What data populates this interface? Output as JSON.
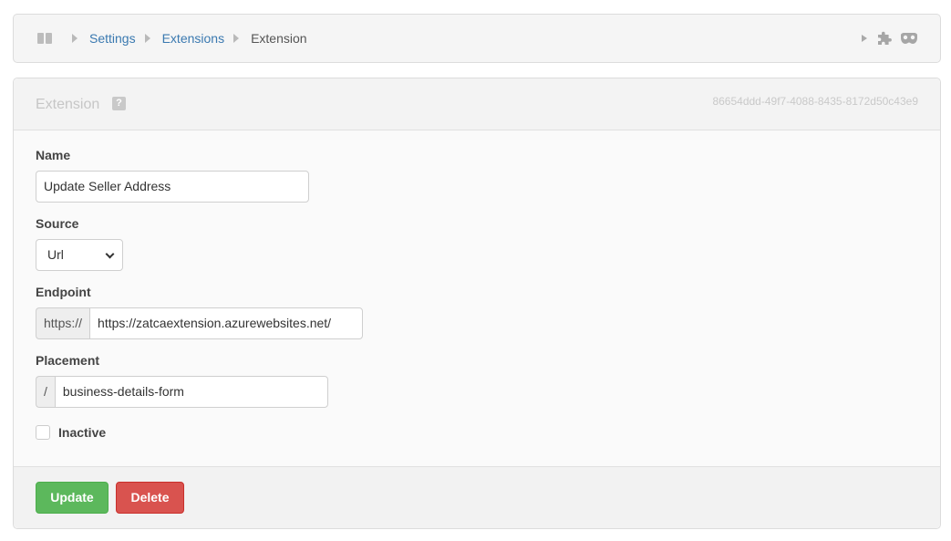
{
  "breadcrumb": {
    "items": [
      {
        "label": "Settings"
      },
      {
        "label": "Extensions"
      }
    ],
    "current": "Extension",
    "icons": [
      "panel-toggle-icon",
      "play-icon",
      "puzzle-icon",
      "mask-icon"
    ]
  },
  "panel": {
    "title": "Extension",
    "help": "?",
    "record_id": "86654ddd-49f7-4088-8435-8172d50c43e9"
  },
  "form": {
    "name": {
      "label": "Name",
      "value": "Update Seller Address"
    },
    "source": {
      "label": "Source",
      "value": "Url"
    },
    "endpoint": {
      "label": "Endpoint",
      "prefix": "https://",
      "value": "https://zatcaextension.azurewebsites.net/"
    },
    "placement": {
      "label": "Placement",
      "prefix": "/",
      "value": "business-details-form"
    },
    "inactive": {
      "label": "Inactive",
      "checked": false
    }
  },
  "footer": {
    "update_label": "Update",
    "delete_label": "Delete"
  },
  "colors": {
    "link": "#3a79b0",
    "success": "#5cb85c",
    "danger": "#d9534f"
  }
}
